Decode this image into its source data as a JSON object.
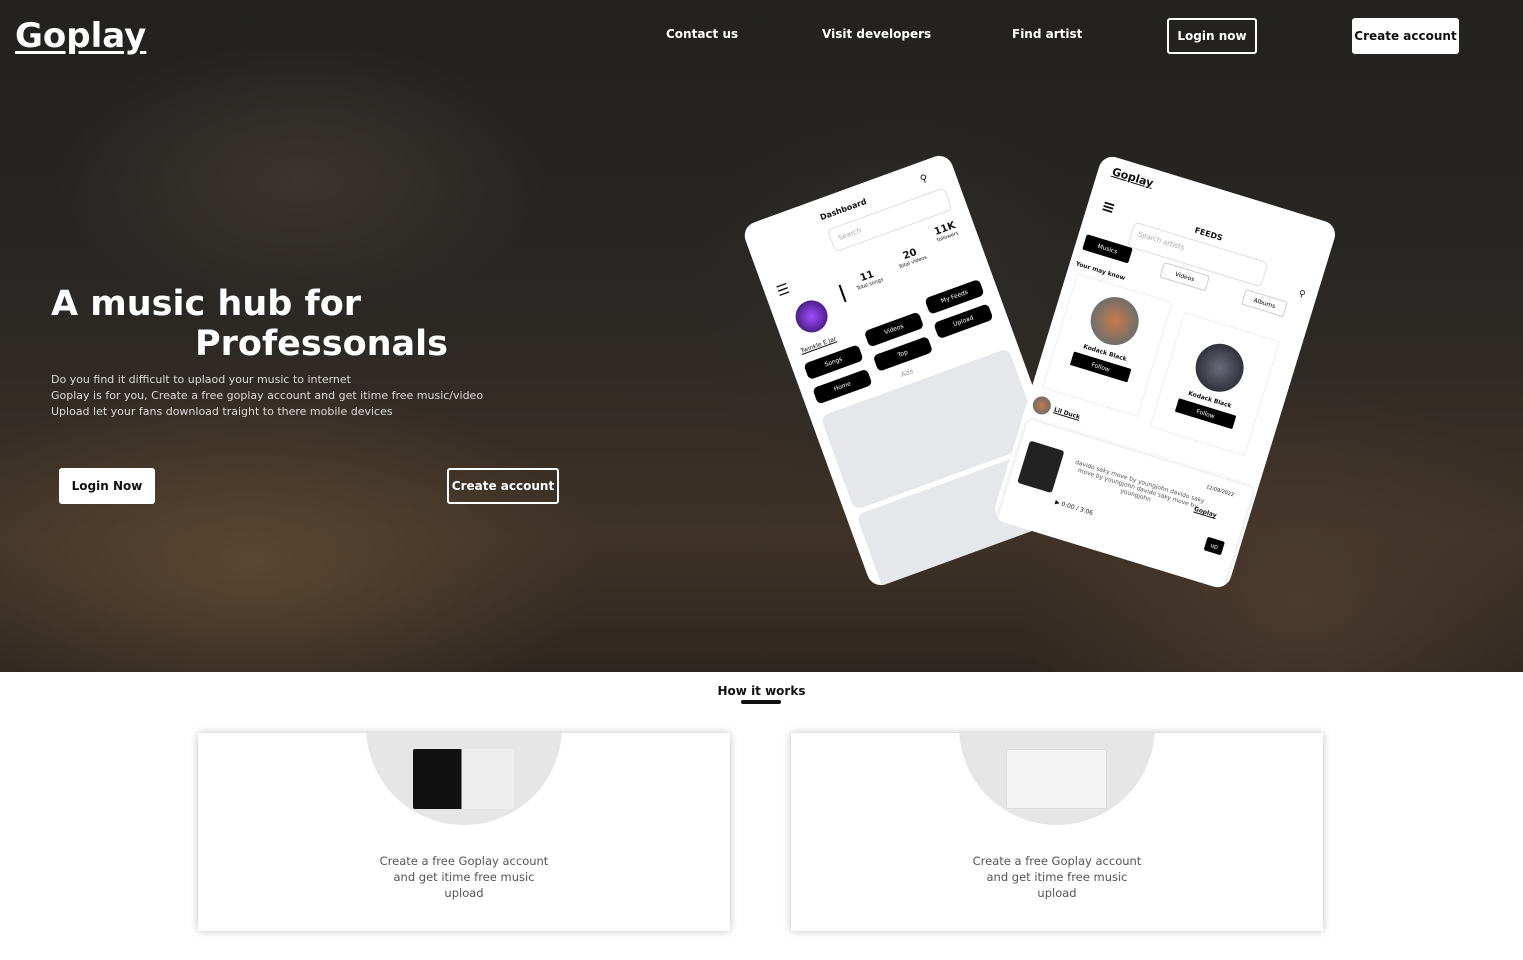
{
  "header": {
    "logo": "Goplay",
    "nav": [
      "Contact us",
      "Visit developers",
      "Find artist"
    ],
    "login": "Login now",
    "create": "Create account"
  },
  "hero": {
    "title_line1": "A music hub for",
    "title_line2": "Professonals",
    "desc": [
      "Do you find it difficult to uplaod your music to internet",
      "Goplay is for you, Create a free goplay account and get itime free music/video",
      "Upload let your fans download traight to there mobile devices"
    ],
    "login_button": "Login Now",
    "create_button": "Create account"
  },
  "dashboard_mock": {
    "title": "Dashboard",
    "search": "Search",
    "stats": [
      {
        "value": "11",
        "label": "Total songs"
      },
      {
        "value": "20",
        "label": "Total videos"
      },
      {
        "value": "11K",
        "label": "followers"
      }
    ],
    "user": "Twinkle E Jar",
    "buttons": [
      "Songs",
      "Videos",
      "My Feeds",
      "Home",
      "Top",
      "Upload"
    ],
    "ads": "Ads"
  },
  "feed_mock": {
    "logo": "Goplay",
    "title": "FEEDS",
    "search": "Search artists",
    "tabs": [
      "Musics",
      "Videos",
      "Albums"
    ],
    "you_may_know": "Your may know",
    "artists": [
      {
        "name": "Kodack Black",
        "follow": "Follow"
      },
      {
        "name": "Kodack Black",
        "follow": "Follow"
      }
    ],
    "poster": "Lil Duck",
    "date": "12/09/2022",
    "post_text": "davido saky move by youngjohn davido saky move by youngjohn davido saky move by youngjohn",
    "brand": "Goplay",
    "time": "0:00 / 3:06",
    "up": "up"
  },
  "how": {
    "title": "How it works",
    "cards": [
      {
        "text": "Create a free Goplay account and get itime free music upload"
      },
      {
        "text": "Create a free Goplay account and get itime free music upload"
      }
    ]
  }
}
